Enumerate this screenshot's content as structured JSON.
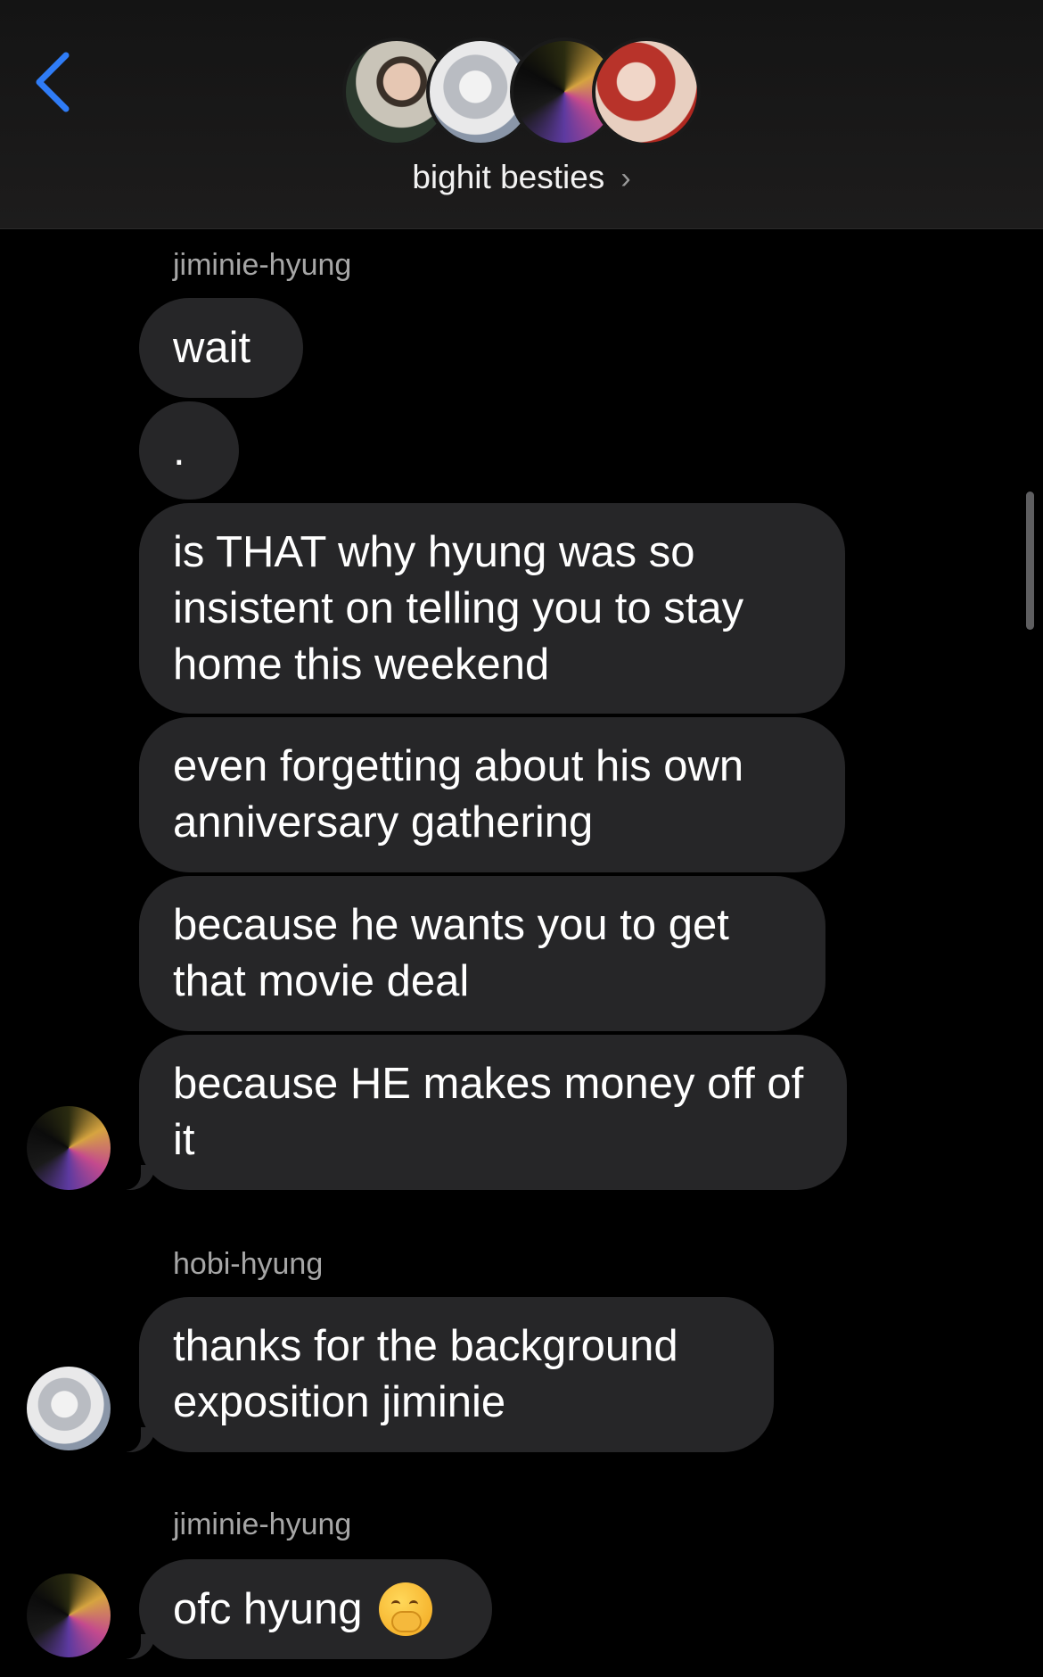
{
  "header": {
    "title": "bighit besties",
    "back_icon": "chevron-left-icon",
    "title_chevron": "›",
    "accent_color": "#2f7cf6"
  },
  "messages": [
    {
      "sender": "jiminie-hyung"
    },
    {
      "text": "wait"
    },
    {
      "text": "."
    },
    {
      "text": "is THAT why hyung was so insistent on telling you to stay home this weekend"
    },
    {
      "text": "even forgetting about his own anniversary gathering"
    },
    {
      "text": "because he wants you to get that movie deal"
    },
    {
      "text": "because HE makes money off of it"
    },
    {
      "sender": "hobi-hyung"
    },
    {
      "text": "thanks for the background exposition jiminie"
    },
    {
      "sender": "jiminie-hyung"
    },
    {
      "text": "ofc hyung",
      "emoji": "face-with-hand-over-mouth"
    }
  ],
  "colors": {
    "bubble_incoming": "#262628",
    "sender_label": "#a6a6a6",
    "background": "#000000"
  }
}
